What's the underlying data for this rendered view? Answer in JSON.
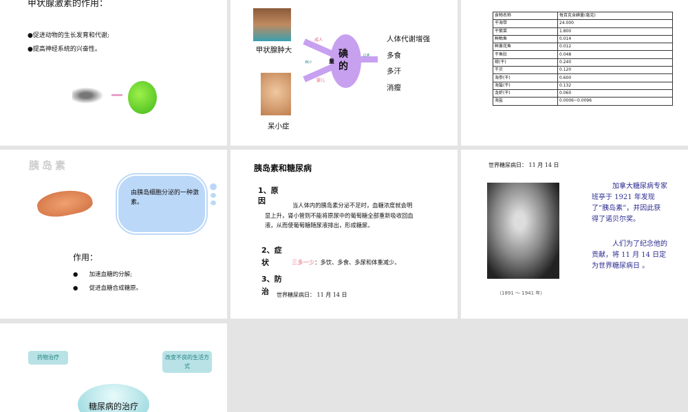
{
  "slides": [
    {
      "title": "甲状腺激素的作用：",
      "bullets": [
        "●促进动物的生长发育和代谢;",
        "●提高神经系统的兴奋性。"
      ]
    },
    {
      "left_top": "甲状腺肿大",
      "left_bottom": "呆小症",
      "center": "碘的",
      "center_small": "量",
      "adult": "成人",
      "infant": "婴儿",
      "lack": "缺少",
      "excess": "过多",
      "effects": [
        "人体代谢增强",
        "多食",
        "多汗",
        "消瘦"
      ]
    },
    {
      "table": {
        "headers": [
          "食物名称",
          "每百克含碘量(毫克)"
        ],
        "rows": [
          [
            "干海带",
            "24.000"
          ],
          [
            "干紫菜",
            "1.800"
          ],
          [
            "鲜鲐鱼",
            "0.014"
          ],
          [
            "鲜黄花鱼",
            "0.012"
          ],
          [
            "干鱼肚",
            "0.048"
          ],
          [
            "蚶(干)",
            "0.240"
          ],
          [
            "干贝",
            "0.120"
          ],
          [
            "海参(干)",
            "0.600"
          ],
          [
            "海蜇(干)",
            "0.132"
          ],
          [
            "龙虾(干)",
            "0.060"
          ],
          [
            "海盐",
            "0.0006~0.0096"
          ]
        ]
      }
    },
    {
      "title": "胰岛素",
      "bubble": "由胰岛细胞分泌的一种激素。",
      "role": "作用：",
      "bullets": [
        "加速血糖的分解;",
        "促进血糖合成糖原。"
      ]
    },
    {
      "title": "胰岛素和糖尿病",
      "h1": "1、原因",
      "p1": "当人体内的胰岛素分泌不足时，血糖浓度就会明显上升，肾小管则不能将原尿中的葡萄糖全部重新吸收回血液，从而使葡萄糖随尿液排出，形成糖尿。",
      "h2": "2、症状",
      "sym_red": "三多一少",
      "sym": "：多饮、多食、多尿和体重减少。",
      "h3": "3、防治",
      "day": "世界糖尿病日： 11 月 14 日"
    },
    {
      "day": "世界糖尿病日： 11 月 14 日",
      "caption": "（1891 ～ 1941 年）",
      "p1": "加拿大糖尿病专家班亭于 1921 年发现了“胰岛素”，并因此获得了诺贝尔奖。",
      "p2": "人们为了纪念他的贡献，将 11 月 14 日定为世界糖尿病日 。"
    },
    {
      "left": "药物治疗",
      "right": "改变不良的生活方式",
      "center": "糖尿病的治疗"
    }
  ]
}
